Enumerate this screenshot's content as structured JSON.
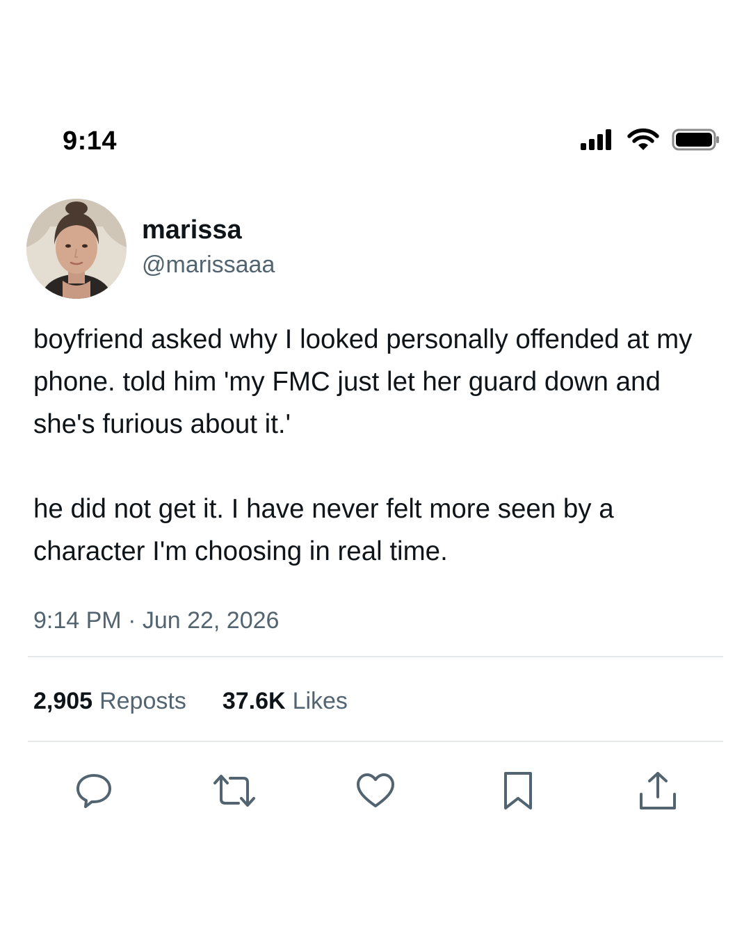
{
  "status_bar": {
    "time": "9:14",
    "icons": [
      "cellular-signal-icon",
      "wifi-icon",
      "battery-icon"
    ]
  },
  "post": {
    "author": {
      "display_name": "marissa",
      "handle": "@marissaaa",
      "avatar": "profile-photo"
    },
    "paragraphs": [
      "boyfriend asked why I looked personally offended at my phone. told him 'my FMC just let her guard down and she's furious about it.'",
      "he did not get it. I have never felt more seen by a character I'm choosing in real time."
    ],
    "timestamp": "9:14 PM · Jun 22, 2026",
    "stats": {
      "reposts_count": "2,905",
      "reposts_label": "Reposts",
      "likes_count": "37.6K",
      "likes_label": "Likes"
    }
  },
  "actions": [
    {
      "name": "reply",
      "icon": "reply-icon"
    },
    {
      "name": "repost",
      "icon": "repost-icon"
    },
    {
      "name": "like",
      "icon": "heart-icon"
    },
    {
      "name": "bookmark",
      "icon": "bookmark-icon"
    },
    {
      "name": "share",
      "icon": "share-icon"
    }
  ],
  "colors": {
    "text_primary": "#0f1419",
    "text_secondary": "#536471",
    "divider": "#e6e9eb",
    "icon": "#536471"
  }
}
